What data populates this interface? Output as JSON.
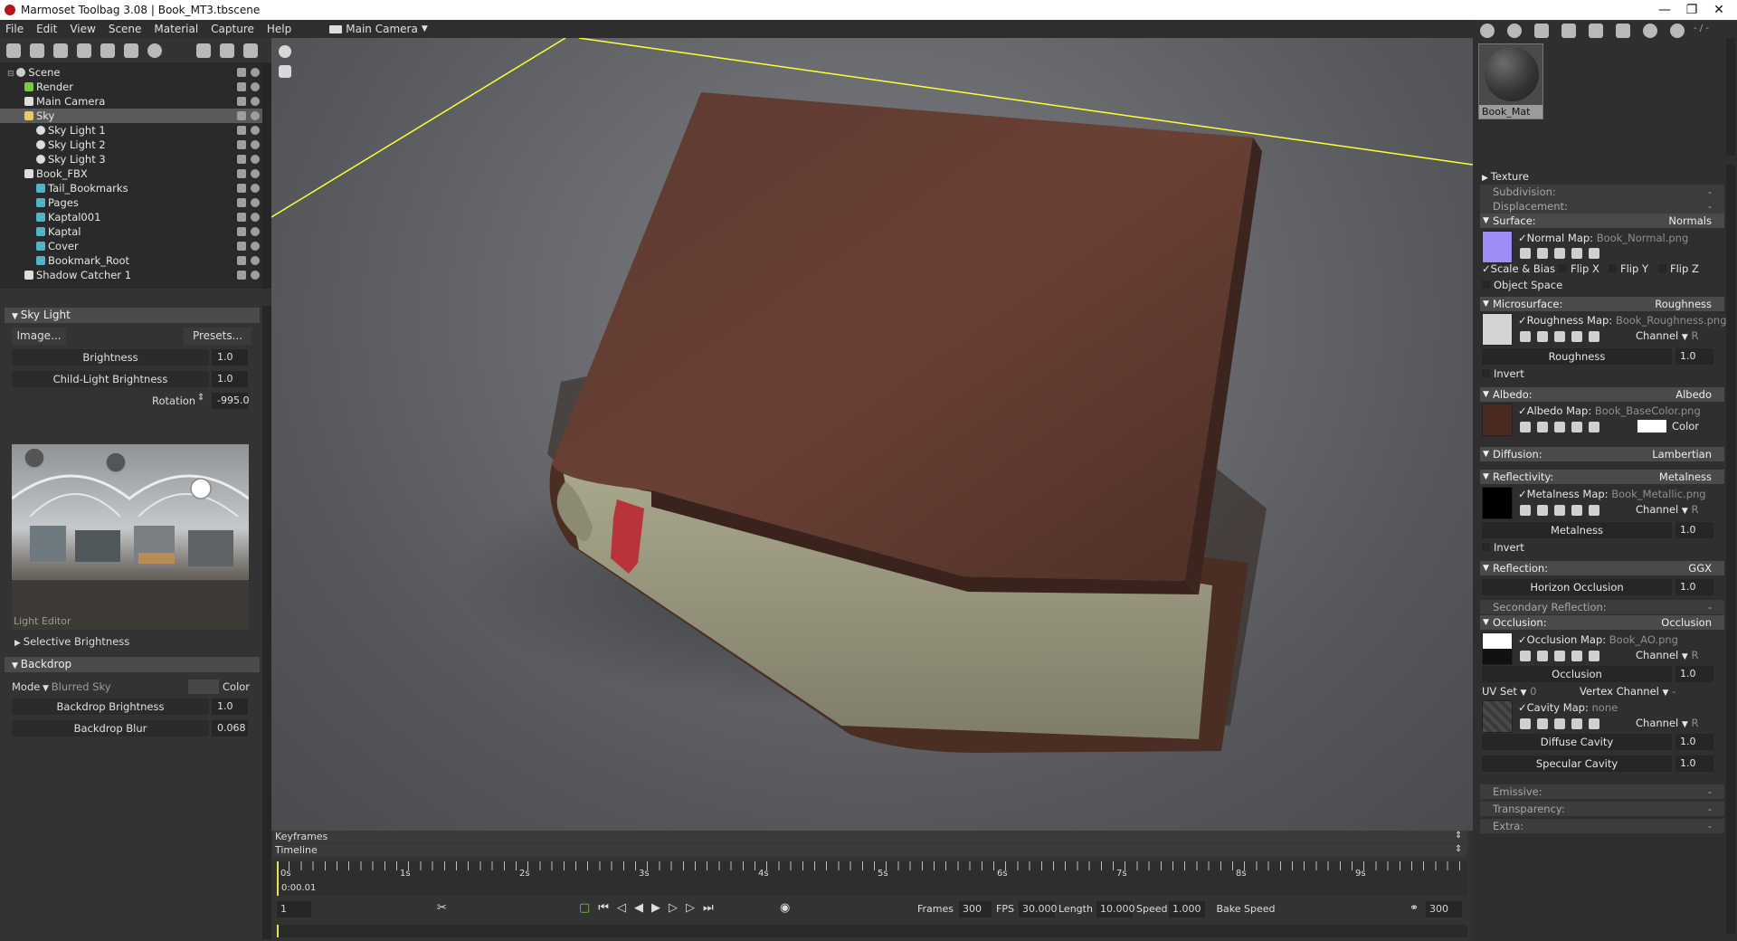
{
  "window": {
    "title": "Marmoset Toolbag 3.08  |  Book_MT3.tbscene",
    "minimize": "—",
    "restore": "❐",
    "close": "✕"
  },
  "menu": [
    "File",
    "Edit",
    "View",
    "Scene",
    "Material",
    "Capture",
    "Help"
  ],
  "camera_selector": "Main Camera",
  "scene_tree": [
    {
      "label": "Scene"
    },
    {
      "label": "Render"
    },
    {
      "label": "Main Camera"
    },
    {
      "label": "Sky"
    },
    {
      "label": "Sky Light 1"
    },
    {
      "label": "Sky Light 2"
    },
    {
      "label": "Sky Light 3"
    },
    {
      "label": "Book_FBX"
    },
    {
      "label": "Tail_Bookmarks"
    },
    {
      "label": "Pages"
    },
    {
      "label": "Kaptal001"
    },
    {
      "label": "Kaptal"
    },
    {
      "label": "Cover"
    },
    {
      "label": "Bookmark_Root"
    },
    {
      "label": "Shadow Catcher 1"
    }
  ],
  "sky_light": {
    "header": "Sky Light",
    "image_btn": "Image...",
    "presets_btn": "Presets...",
    "brightness_label": "Brightness",
    "brightness_value": "1.0",
    "child_brightness_label": "Child-Light Brightness",
    "child_brightness_value": "1.0",
    "rotation_label": "Rotation",
    "rotation_value": "-995.0",
    "light_editor_label": "Light Editor",
    "selective_brightness": "Selective Brightness"
  },
  "backdrop": {
    "header": "Backdrop",
    "mode_label": "Mode",
    "mode_value": "Blurred Sky",
    "color_label": "Color",
    "brightness_label": "Backdrop Brightness",
    "brightness_value": "1.0",
    "blur_label": "Backdrop Blur",
    "blur_value": "0.068"
  },
  "timeline": {
    "keyframes_label": "Keyframes",
    "timeline_label": "Timeline",
    "ticks": [
      "0s",
      "1s",
      "2s",
      "3s",
      "4s",
      "5s",
      "6s",
      "7s",
      "8s",
      "9s"
    ],
    "current_time": "0:00.01",
    "frame_field": "1",
    "frames_label": "Frames",
    "frames_value": "300",
    "fps_label": "FPS",
    "fps_value": "30.000",
    "length_label": "Length",
    "length_value": "10.000",
    "speed_label": "Speed",
    "speed_value": "1.000",
    "bake_speed": "Bake Speed",
    "end_value": "300"
  },
  "material_panel": {
    "counter": "- / -",
    "material_name": "Book_Mat",
    "texture": "Texture",
    "subdivision": "Subdivision:",
    "subdivision_value": "-",
    "displacement": "Displacement:",
    "displacement_value": "-",
    "surface": "Surface:",
    "surface_value": "Normals",
    "normal_map_label": "Normal Map:",
    "normal_map_file": "Book_Normal.png",
    "scale_bias": "Scale & Bias",
    "flip_x": "Flip X",
    "flip_y": "Flip Y",
    "flip_z": "Flip Z",
    "object_space": "Object Space",
    "microsurface": "Microsurface:",
    "microsurface_value": "Roughness",
    "roughness_map_label": "Roughness Map:",
    "roughness_map_file": "Book_Roughness.png",
    "channel_label": "Channel",
    "channel_value": "R",
    "roughness_label": "Roughness",
    "roughness_value": "1.0",
    "invert": "Invert",
    "albedo": "Albedo:",
    "albedo_value": "Albedo",
    "albedo_map_label": "Albedo Map:",
    "albedo_map_file": "Book_BaseColor.png",
    "color_label": "Color",
    "diffusion": "Diffusion:",
    "diffusion_value": "Lambertian",
    "reflectivity": "Reflectivity:",
    "reflectivity_value": "Metalness",
    "metalness_map_label": "Metalness Map:",
    "metalness_map_file": "Book_Metallic.png",
    "metalness_label": "Metalness",
    "metalness_value": "1.0",
    "reflection": "Reflection:",
    "reflection_value": "GGX",
    "horizon_occlusion": "Horizon Occlusion",
    "horizon_value": "1.0",
    "secondary_reflection": "Secondary Reflection:",
    "secondary_value": "-",
    "occlusion": "Occlusion:",
    "occlusion_value": "Occlusion",
    "occlusion_map_label": "Occlusion Map:",
    "occlusion_map_file": "Book_AO.png",
    "occlusion_label": "Occlusion",
    "occlusion_amount": "1.0",
    "uv_set_label": "UV Set",
    "uv_set_value": "0",
    "vertex_channel_label": "Vertex Channel",
    "vertex_channel_value": "-",
    "cavity_map_label": "Cavity Map:",
    "cavity_map_file": "none",
    "diffuse_cavity": "Diffuse Cavity",
    "diffuse_cavity_value": "1.0",
    "specular_cavity": "Specular Cavity",
    "specular_cavity_value": "1.0",
    "emissive": "Emissive:",
    "emissive_value": "-",
    "transparency": "Transparency:",
    "transparency_value": "-",
    "extra": "Extra:",
    "extra_value": "-"
  }
}
